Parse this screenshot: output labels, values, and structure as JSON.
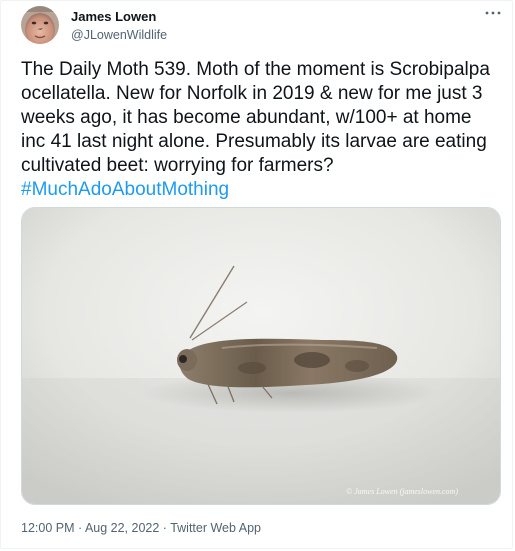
{
  "author": {
    "name": "James Lowen",
    "handle": "@JLowenWildlife"
  },
  "more_icon": "more-horizontal-icon",
  "tweet": {
    "text": "The Daily Moth 539. Moth of the moment is Scrobipalpa ocellatella. New for Norfolk in 2019 & new for me just 3 weeks ago, it has become abundant, w/100+ at home inc 41 last night alone. Presumably its larvae are eating cultivated beet: worrying for farmers? ",
    "hashtag": "#MuchAdoAboutMothing"
  },
  "media": {
    "watermark": "© James Lowen (jameslowen.com)"
  },
  "meta": {
    "time": "12:00 PM",
    "separator": " · ",
    "date": "Aug 22, 2022",
    "source": "Twitter Web App"
  },
  "colors": {
    "hashtag": "#1d9bf0",
    "secondary_text": "#536471",
    "border": "#cfd9de"
  }
}
